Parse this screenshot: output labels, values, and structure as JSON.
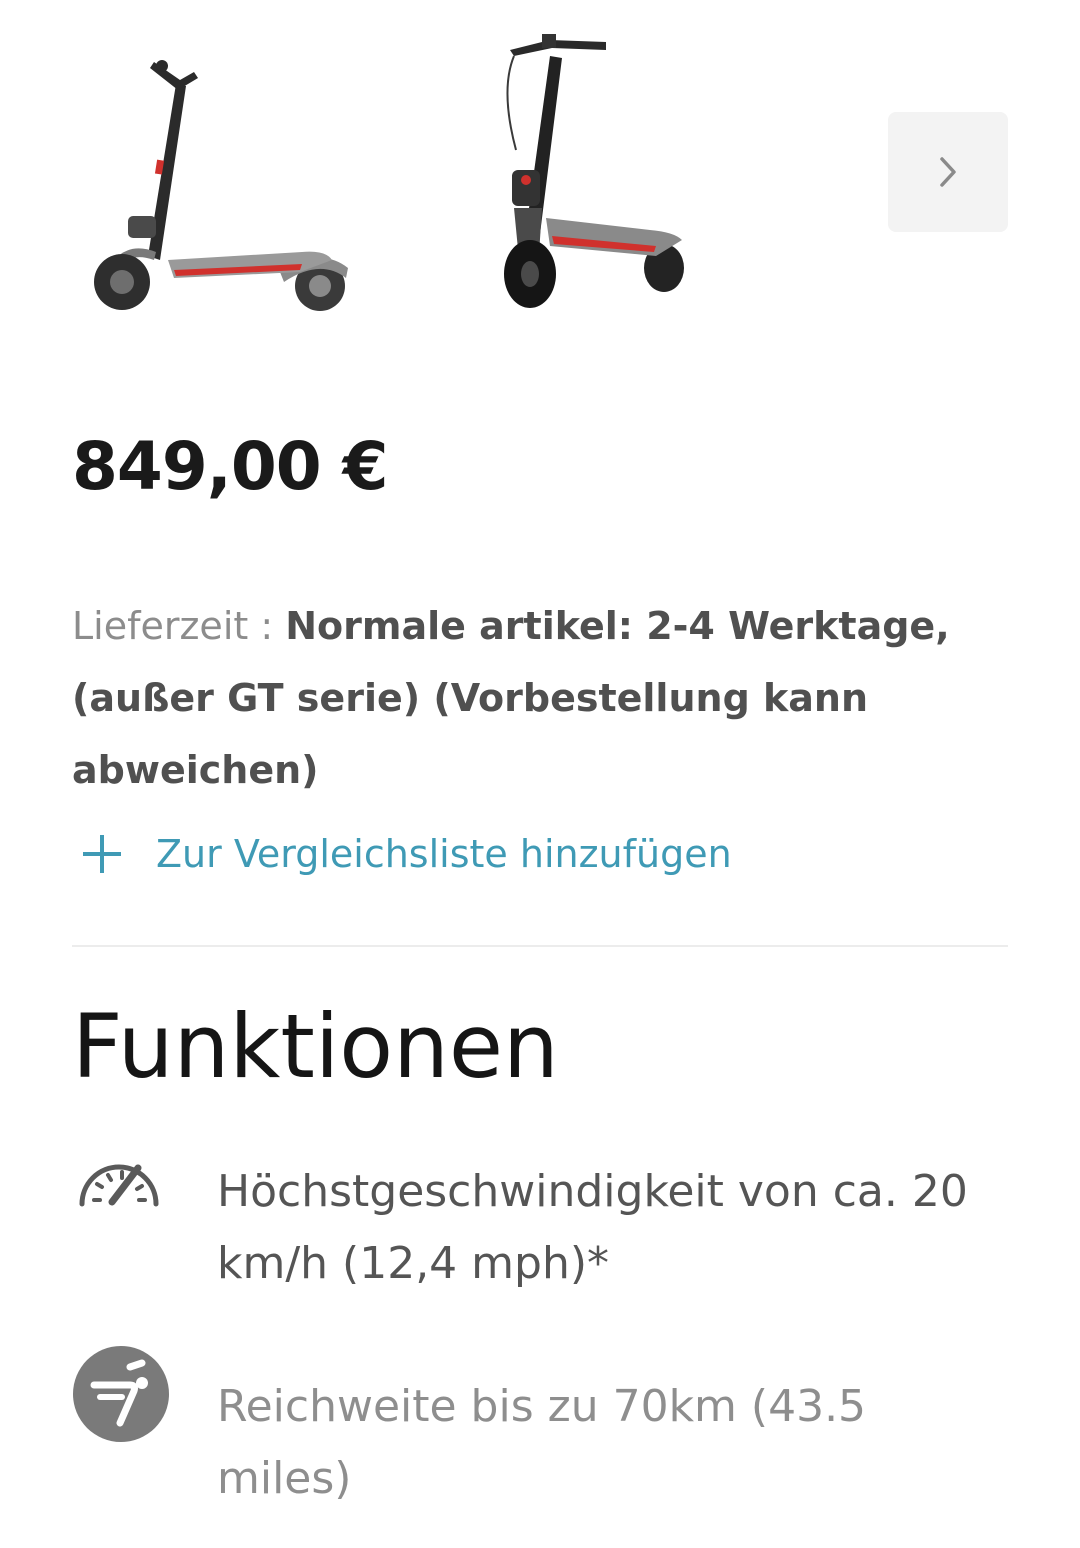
{
  "gallery": {
    "images": [
      {
        "alt": "scooter-side-view"
      },
      {
        "alt": "scooter-front-view"
      }
    ],
    "next_icon": "chevron-right-icon"
  },
  "product": {
    "price": "849,00 €"
  },
  "delivery": {
    "label": "Lieferzeit : ",
    "value": "Normale artikel: 2-4 Werktage, (außer GT serie) (Vorbestellung kann abweichen)"
  },
  "compare": {
    "icon": "plus-icon",
    "label": "Zur Vergleichsliste hinzufügen"
  },
  "features": {
    "title": "Funktionen",
    "items": [
      {
        "icon": "speedometer-icon",
        "text": "Höchstgeschwindigkeit von ca. 20 km/h (12,4 mph)*"
      },
      {
        "icon": "range-icon",
        "text": "Reichweite bis zu 70km (43.5 miles)"
      }
    ]
  },
  "colors": {
    "accent": "#3f9ab5",
    "scooter_red": "#d0312d",
    "text_dark": "#1a1a1a",
    "text_muted": "#8c8c8c"
  }
}
